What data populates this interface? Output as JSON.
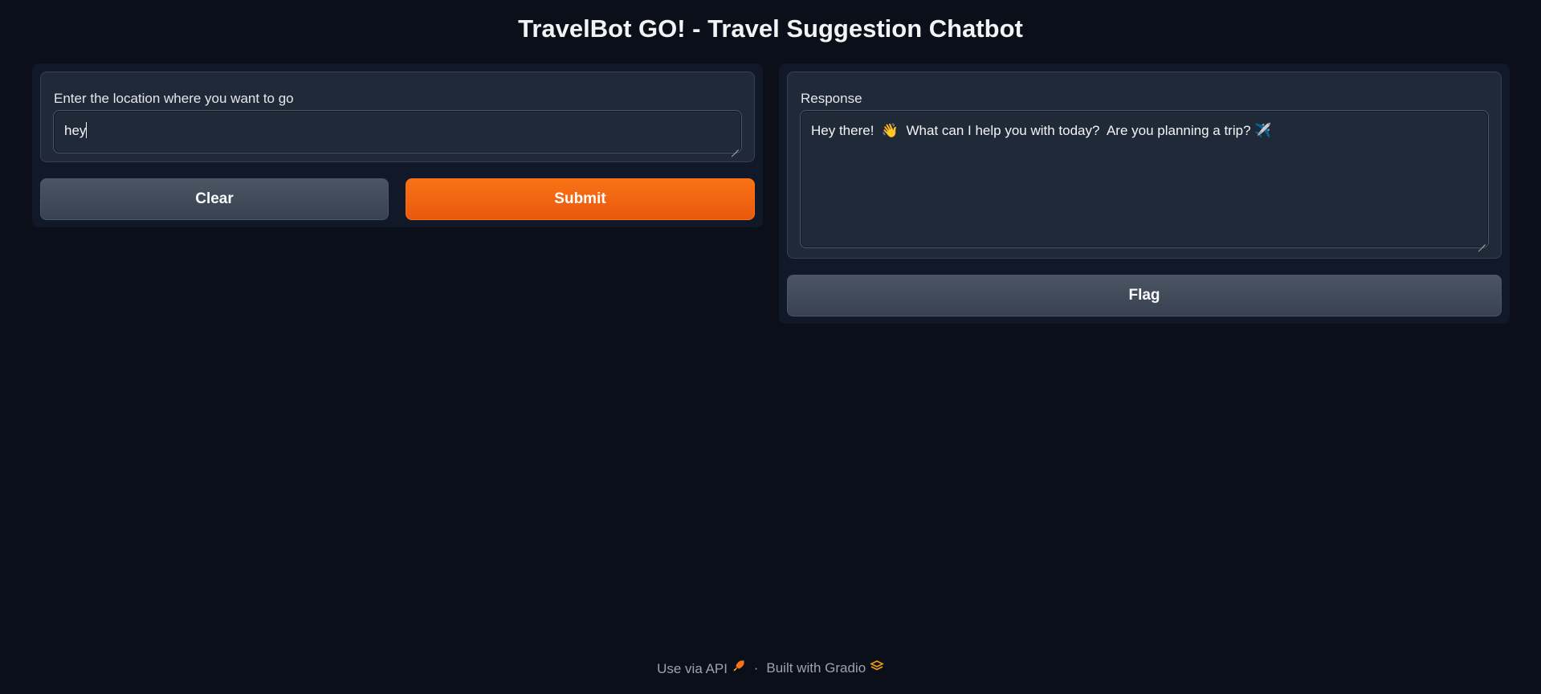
{
  "app": {
    "title": "TravelBot GO! - Travel Suggestion Chatbot"
  },
  "input_panel": {
    "label": "Enter the location where you want to go",
    "value": "hey",
    "clear_label": "Clear",
    "submit_label": "Submit"
  },
  "output_panel": {
    "label": "Response",
    "value": "Hey there!  👋  What can I help you with today?  Are you planning a trip? ✈️",
    "flag_label": "Flag"
  },
  "footer": {
    "api_label": "Use via API",
    "separator": "·",
    "built_label": "Built with Gradio"
  },
  "colors": {
    "background": "#0b0f19",
    "panel": "#111827",
    "block": "#1f2937",
    "accent": "#f97316"
  }
}
